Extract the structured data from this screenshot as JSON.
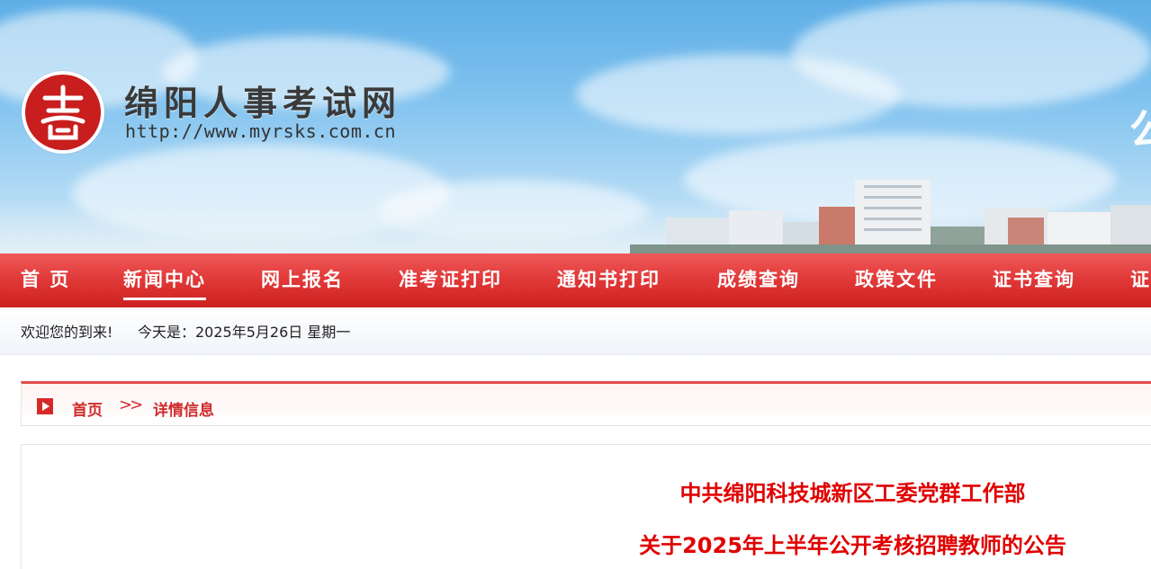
{
  "header": {
    "site_title": "绵阳人事考试网",
    "site_url": "http://www.myrsks.com.cn",
    "edge_glyph": "公"
  },
  "nav": {
    "active_index": 1,
    "items": [
      {
        "label": "首 页"
      },
      {
        "label": "新闻中心"
      },
      {
        "label": "网上报名"
      },
      {
        "label": "准考证打印"
      },
      {
        "label": "通知书打印"
      },
      {
        "label": "成绩查询"
      },
      {
        "label": "政策文件"
      },
      {
        "label": "证书查询"
      },
      {
        "label": "证"
      }
    ]
  },
  "welcome": {
    "greeting": "欢迎您的到来!",
    "date": "今天是：2025年5月26日 星期一"
  },
  "breadcrumb": {
    "home": "首页",
    "separator": ">>",
    "current": "详情信息"
  },
  "article": {
    "title_line1": "中共绵阳科技城新区工委党群工作部",
    "title_line2": "关于2025年上半年公开考核招聘教师的公告"
  },
  "colors": {
    "nav_red": "#e23a3a",
    "accent_red": "#d02b2b",
    "title_red": "#e00000"
  }
}
